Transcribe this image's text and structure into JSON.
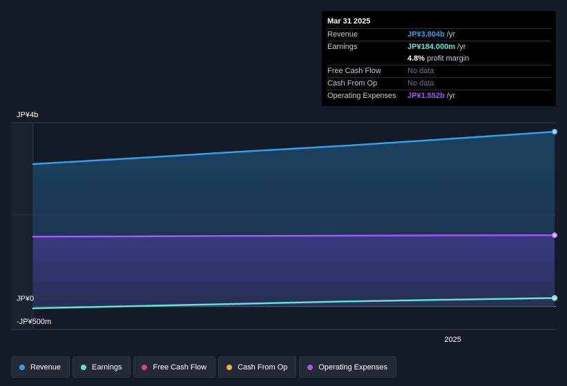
{
  "chart_data": {
    "type": "area",
    "title": "",
    "xlabel": "",
    "ylabel": "",
    "x_ticks": [
      "2025"
    ],
    "y_ticks": [
      "JP¥4b",
      "JP¥0",
      "-JP¥500m"
    ],
    "ylim": [
      -500000000,
      4000000000
    ],
    "grid": true,
    "legend_position": "bottom",
    "x": [
      "2023-12-31",
      "2024-03-31",
      "2024-06-30",
      "2024-09-30",
      "2024-12-31",
      "2025-03-31"
    ],
    "series": [
      {
        "name": "Revenue",
        "color": "#2ea2ef",
        "values": [
          3100000000,
          3230000000,
          3370000000,
          3500000000,
          3650000000,
          3804000000
        ]
      },
      {
        "name": "Earnings",
        "color": "#5ee4d8",
        "values": [
          -40000000,
          10000000,
          60000000,
          110000000,
          150000000,
          184000000
        ]
      },
      {
        "name": "Operating Expenses",
        "color": "#a855f7",
        "values": [
          1520000000,
          1527000000,
          1535000000,
          1542000000,
          1548000000,
          1552000000
        ]
      }
    ]
  },
  "tooltip": {
    "date": "Mar 31 2025",
    "rows": [
      {
        "label": "Revenue",
        "value": "JP¥3.804b",
        "unit": "/yr",
        "color": "#2ea2ef"
      },
      {
        "label": "Earnings",
        "value": "JP¥184.000m",
        "unit": "/yr",
        "color": "#5ee4d8"
      },
      {
        "label": "",
        "value": "4.8%",
        "unit": "profit margin",
        "color": "#ffffff"
      },
      {
        "label": "Free Cash Flow",
        "value": "No data",
        "unit": "",
        "color": "#6c7380"
      },
      {
        "label": "Cash From Op",
        "value": "No data",
        "unit": "",
        "color": "#6c7380"
      },
      {
        "label": "Operating Expenses",
        "value": "JP¥1.552b",
        "unit": "/yr",
        "color": "#a855f7"
      }
    ]
  },
  "legend": [
    {
      "label": "Revenue",
      "color": "#2ea2ef"
    },
    {
      "label": "Earnings",
      "color": "#5ee4d8"
    },
    {
      "label": "Free Cash Flow",
      "color": "#d6457c"
    },
    {
      "label": "Cash From Op",
      "color": "#f0b155"
    },
    {
      "label": "Operating Expenses",
      "color": "#a855f7"
    }
  ]
}
